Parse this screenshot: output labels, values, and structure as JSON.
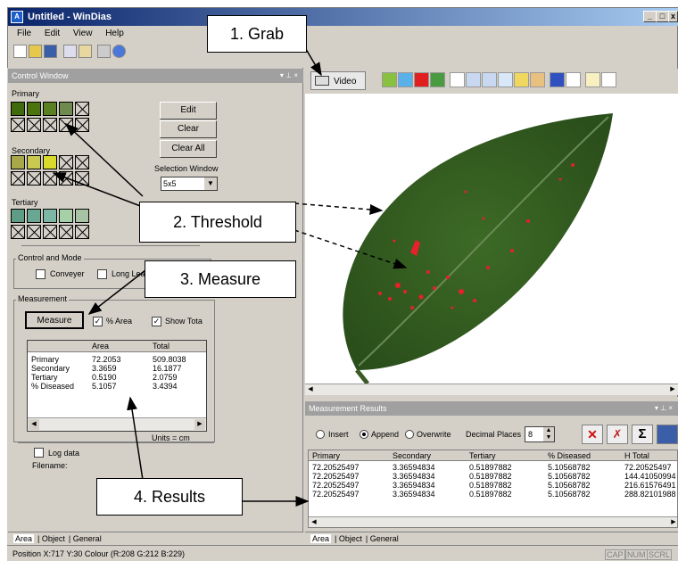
{
  "window": {
    "title": "Untitled - WinDias",
    "icon_text": "A"
  },
  "menu": [
    "File",
    "Edit",
    "View",
    "Help"
  ],
  "control": {
    "title": "Control Window",
    "primary": "Primary",
    "secondary": "Secondary",
    "tertiary": "Tertiary",
    "edit": "Edit",
    "clear": "Clear",
    "clear_all": "Clear All",
    "selection_label": "Selection Window",
    "selection_value": "5x5",
    "mode_title": "Control and Mode",
    "conveyer": "Conveyer",
    "long_leaf": "Long Leaf",
    "meas_title": "Measurement",
    "measure_btn": "Measure",
    "pct_area": "% Area",
    "show_total": "Show Tota",
    "table_headers": [
      "",
      "Area",
      "Total"
    ],
    "rows": [
      [
        "Primary",
        "72.2053",
        "509.8038"
      ],
      [
        "Secondary",
        "3.3659",
        "16.1877"
      ],
      [
        "Tertiary",
        "0.5190",
        "2.0759"
      ],
      [
        "% Diseased",
        "5.1057",
        "3.4394"
      ]
    ],
    "units": "Units = cm",
    "log_data": "Log data",
    "filename": "Filename:",
    "colors": {
      "primary": [
        "#3f6b0c",
        "#4c740e",
        "#5b8022",
        "#6f8a4e"
      ],
      "secondary": [
        "#a8a84a",
        "#c9c94f",
        "#dada2c"
      ],
      "tertiary": [
        "#5e9c86",
        "#6aa694",
        "#7cb6a4",
        "#a6d0a8",
        "#a7c2a4"
      ]
    }
  },
  "left_tabs": [
    "Area",
    "Object",
    "General"
  ],
  "video_btn": "Video",
  "results": {
    "title": "Measurement Results",
    "insert": "Insert",
    "append": "Append",
    "overwrite": "Overwrite",
    "decimal_label": "Decimal Places",
    "decimal_value": "8",
    "headers": [
      "Primary",
      "Secondary",
      "Tertiary",
      "% Diseased",
      "H Total"
    ],
    "rows": [
      [
        "72.20525497",
        "3.36594834",
        "0.51897882",
        "5.10568782",
        "72.20525497"
      ],
      [
        "72.20525497",
        "3.36594834",
        "0.51897882",
        "5.10568782",
        "144.41050994"
      ],
      [
        "72.20525497",
        "3.36594834",
        "0.51897882",
        "5.10568782",
        "216.61576491"
      ],
      [
        "72.20525497",
        "3.36594834",
        "0.51897882",
        "5.10568782",
        "288.82101988"
      ]
    ]
  },
  "right_tabs": [
    "Area",
    "Object",
    "General"
  ],
  "status": {
    "text": "Position  X:717 Y:30  Colour (R:208 G:212 B:229)",
    "cap": "CAP",
    "num": "NUM",
    "scrl": "SCRL"
  },
  "callouts": {
    "grab": "1. Grab",
    "threshold": "2. Threshold",
    "measure": "3. Measure",
    "results": "4. Results"
  }
}
